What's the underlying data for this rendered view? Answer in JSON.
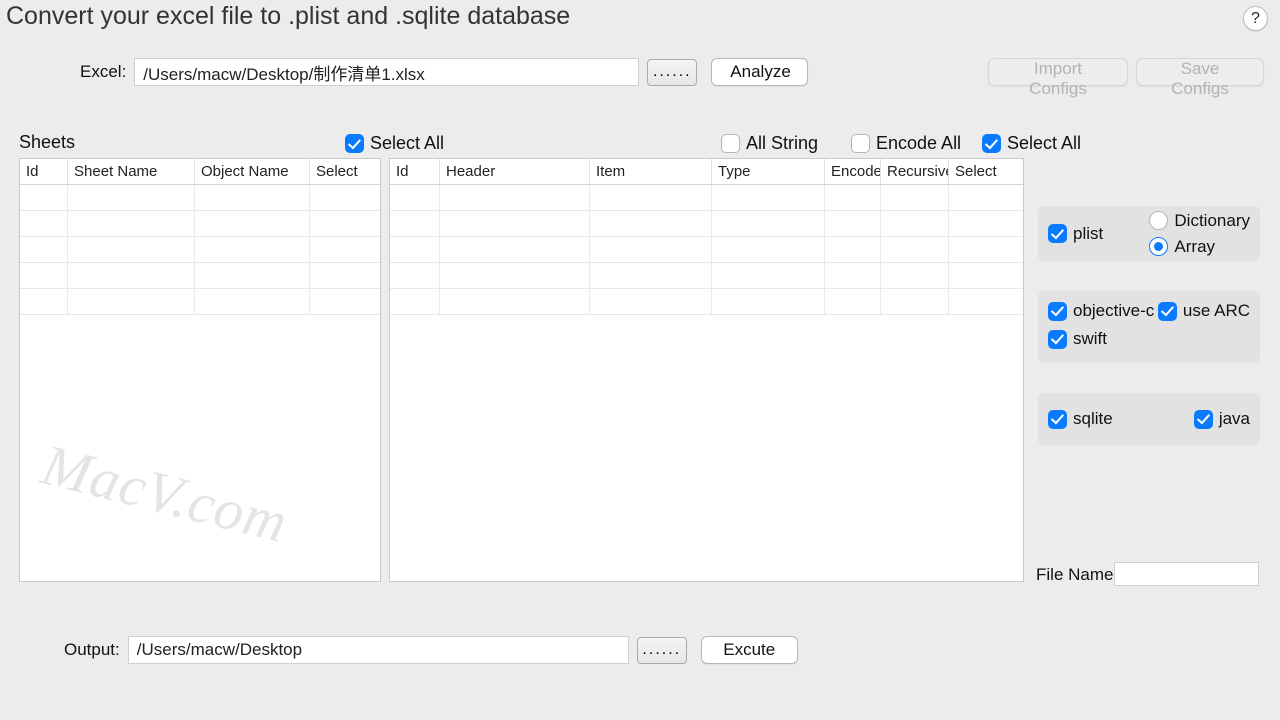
{
  "title": "Convert your excel file to .plist and .sqlite database",
  "help": "?",
  "excel": {
    "label": "Excel:",
    "path": "/Users/macw/Desktop/制作清单1.xlsx",
    "browse": "......",
    "analyze": "Analyze"
  },
  "buttons": {
    "import": "Import Configs",
    "save": "Save Configs"
  },
  "sheets": {
    "label": "Sheets",
    "select_all": "Select All"
  },
  "columns_header": {
    "all_string": "All String",
    "encode_all": "Encode All",
    "select_all": "Select All"
  },
  "left_cols": [
    "Id",
    "Sheet Name",
    "Object Name",
    "Select"
  ],
  "right_cols": [
    "Id",
    "Header",
    "Item",
    "Type",
    "Encode",
    "Recursive",
    "Select"
  ],
  "options": {
    "plist": "plist",
    "dictionary": "Dictionary",
    "array": "Array",
    "objc": "objective-c",
    "arc": "use ARC",
    "swift": "swift",
    "sqlite": "sqlite",
    "java": "java"
  },
  "filename_label": "File Name",
  "output": {
    "label": "Output:",
    "path": "/Users/macw/Desktop",
    "browse": "......",
    "execute": "Excute"
  },
  "watermark": "MacV.com"
}
